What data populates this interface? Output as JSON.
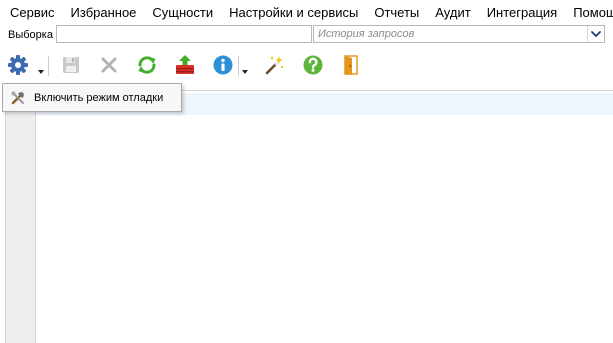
{
  "menu": {
    "items": [
      {
        "label": "Сервис"
      },
      {
        "label": "Избранное"
      },
      {
        "label": "Сущности"
      },
      {
        "label": "Настройки и сервисы"
      },
      {
        "label": "Отчеты"
      },
      {
        "label": "Аудит"
      },
      {
        "label": "Интеграция"
      },
      {
        "label": "Помощь"
      }
    ]
  },
  "query": {
    "label": "Выборка",
    "value": "",
    "history_placeholder": "История запросов"
  },
  "toolbar": {
    "icons": [
      "settings-gear-icon",
      "dropdown-arrow-icon",
      "save-disk-icon",
      "delete-x-icon",
      "refresh-icon",
      "export-upload-icon",
      "info-icon",
      "magic-wand-icon",
      "help-question-icon",
      "exit-door-icon"
    ]
  },
  "popup": {
    "items": [
      {
        "label": "Включить режим отладки",
        "icon": "tools-hammer-icon"
      }
    ]
  },
  "colors": {
    "gear_blue": "#3d6ab0",
    "refresh_green": "#3fae2a",
    "info_blue": "#2d8fd6",
    "help_green": "#5db53a",
    "delete_gray": "#b3b3b3",
    "export_red": "#d8312a",
    "door_orange": "#e6961e",
    "line_highlight": "#eef5fc",
    "strip_gray": "#eeeeee"
  }
}
